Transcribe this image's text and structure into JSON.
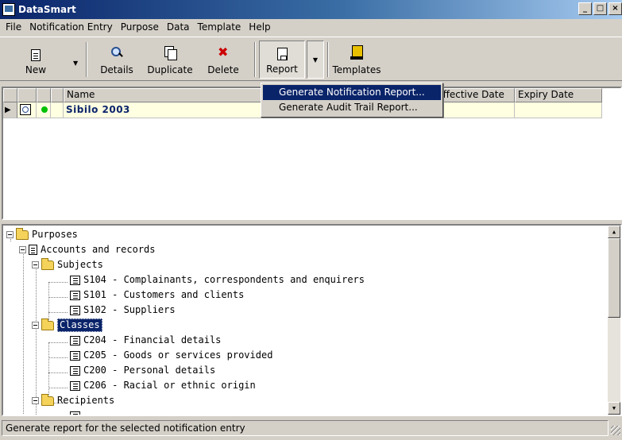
{
  "window": {
    "title": "DataSmart",
    "controls": [
      "_",
      "□",
      "×"
    ]
  },
  "menubar": [
    "File",
    "Notification Entry",
    "Purpose",
    "Data",
    "Template",
    "Help"
  ],
  "toolbar": {
    "new": "New",
    "details": "Details",
    "duplicate": "Duplicate",
    "delete": "Delete",
    "report": "Report",
    "templates": "Templates"
  },
  "report_menu": {
    "items": [
      "Generate Notification Report...",
      "Generate Audit Trail Report..."
    ],
    "highlighted": 0
  },
  "grid": {
    "columns": [
      "Name",
      "Effective Date",
      "Expiry Date"
    ],
    "rows": [
      {
        "name": "Sibilo 2003",
        "effective_date": "",
        "expiry_date": ""
      }
    ]
  },
  "tree": {
    "root": "Purposes",
    "purpose": "Accounts and records",
    "subjects_label": "Subjects",
    "subjects": [
      "S104 - Complainants, correspondents and enquirers",
      "S101 - Customers and clients",
      "S102 - Suppliers"
    ],
    "classes_label": "Classes",
    "classes": [
      "C204 - Financial details",
      "C205 - Goods or services provided",
      "C200 - Personal details",
      "C206 - Racial or ethnic origin"
    ],
    "recipients_label": "Recipients"
  },
  "status": "Generate report for the selected notification entry",
  "colors": {
    "title_start": "#0a246a",
    "title_end": "#a6caf0",
    "highlight": "#0a246a",
    "row_bg": "#ffffe1"
  }
}
